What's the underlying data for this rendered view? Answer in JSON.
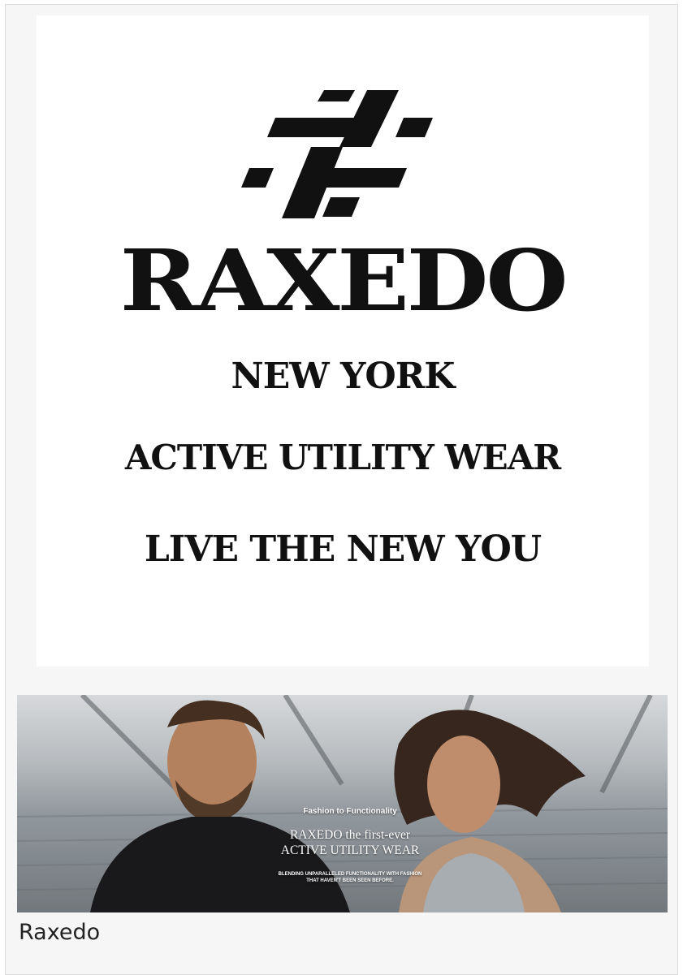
{
  "logo": {
    "icon": "hash-icon",
    "wordmark": "RAXEDO",
    "city": "NEW YORK",
    "tagline": "ACTIVE UTILITY WEAR",
    "slogan": "LIVE THE NEW YOU"
  },
  "banner": {
    "kicker": "Fashion to Functionality",
    "headline_line1": "RAXEDO the first-ever",
    "headline_line2": "ACTIVE UTILITY WEAR",
    "subline_line1": "BLENDING UNPARALLELED FUNCTIONALITY WITH FASHION",
    "subline_line2": "THAT HAVEN'T BEEN SEEN BEFORE."
  },
  "caption": "Raxedo",
  "colors": {
    "card_background": "#f6f6f6",
    "logo_ink": "#111111",
    "banner_text": "#ffffff"
  }
}
